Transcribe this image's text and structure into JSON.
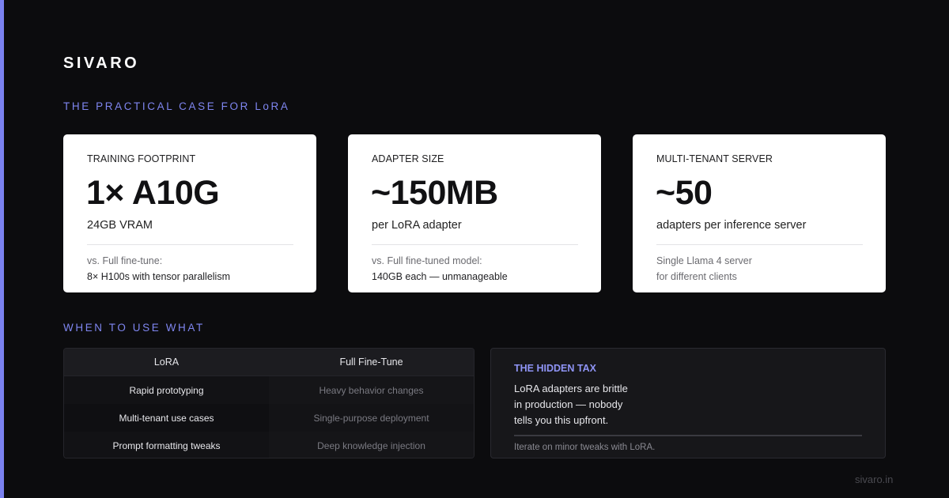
{
  "brand": "SIVARO",
  "sections": {
    "practical_case": "THE PRACTICAL CASE FOR LoRA",
    "when_to_use": "WHEN TO USE WHAT"
  },
  "cards": [
    {
      "label": "TRAINING FOOTPRINT",
      "big": "1× A10G",
      "sub": "24GB VRAM",
      "note_line1": "vs. Full fine-tune:",
      "note_line2": "8× H100s with tensor parallelism"
    },
    {
      "label": "ADAPTER SIZE",
      "big": "~150MB",
      "sub": "per LoRA adapter",
      "note_line1": "vs. Full fine-tuned model:",
      "note_line2": "140GB each — unmanageable"
    },
    {
      "label": "MULTI-TENANT SERVER",
      "big": "~50",
      "sub": "adapters per inference server",
      "note_line1": "Single Llama 4 server",
      "note_line2": "for different clients"
    }
  ],
  "comparison": {
    "headers": [
      "LoRA",
      "Full Fine-Tune"
    ],
    "rows": [
      [
        "Rapid prototyping",
        "Heavy behavior changes"
      ],
      [
        "Multi-tenant use cases",
        "Single-purpose deployment"
      ],
      [
        "Prompt formatting tweaks",
        "Deep knowledge injection"
      ]
    ]
  },
  "hidden_tax": {
    "title": "THE HIDDEN TAX",
    "body_lines": [
      "LoRA adapters are brittle",
      "in production — nobody",
      "tells you this upfront."
    ],
    "footer": "Iterate on minor tweaks with LoRA."
  },
  "footer": "sivaro.in",
  "colors": {
    "background": "#0c0c0e",
    "accent": "#7b82f0",
    "card_bg": "#ffffff"
  }
}
